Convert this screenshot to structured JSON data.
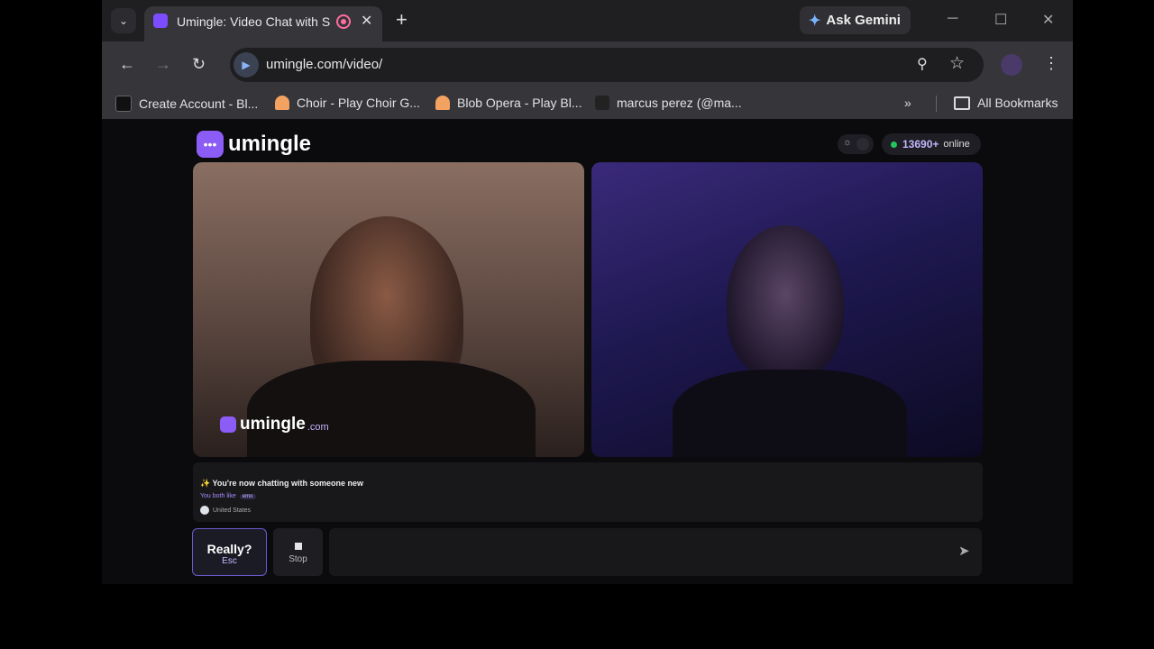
{
  "browser": {
    "tab_title": "Umingle: Video Chat with Strangers",
    "url": "umingle.com/video/",
    "ask_gemini": "Ask Gemini",
    "bookmarks": [
      {
        "label": "Create Account - Bl...",
        "color": "#ffffff"
      },
      {
        "label": "Choir - Play Choir G...",
        "color": "#f4a261"
      },
      {
        "label": "Blob Opera - Play Bl...",
        "color": "#f4a261"
      },
      {
        "label": "marcus perez (@ma...",
        "color": "#222222"
      }
    ],
    "all_bookmarks": "All Bookmarks"
  },
  "site": {
    "logo_text": "umingle",
    "online_count": "13690+",
    "online_label": "online",
    "watermark_text": "umingle",
    "watermark_suffix": ".com",
    "accent_color": "#8b5cf6"
  },
  "chat": {
    "status_line": "✨ You're now chatting with someone new",
    "both_like_label": "You both like",
    "interest_tag": "emo",
    "country": "United States",
    "message_placeholder": ""
  },
  "controls": {
    "really_label": "Really?",
    "really_hotkey": "Esc",
    "stop_label": "Stop"
  },
  "icons": {
    "send": "send-icon",
    "theme": "sun-icon",
    "search": "zoom-icon",
    "star": "star-icon"
  }
}
